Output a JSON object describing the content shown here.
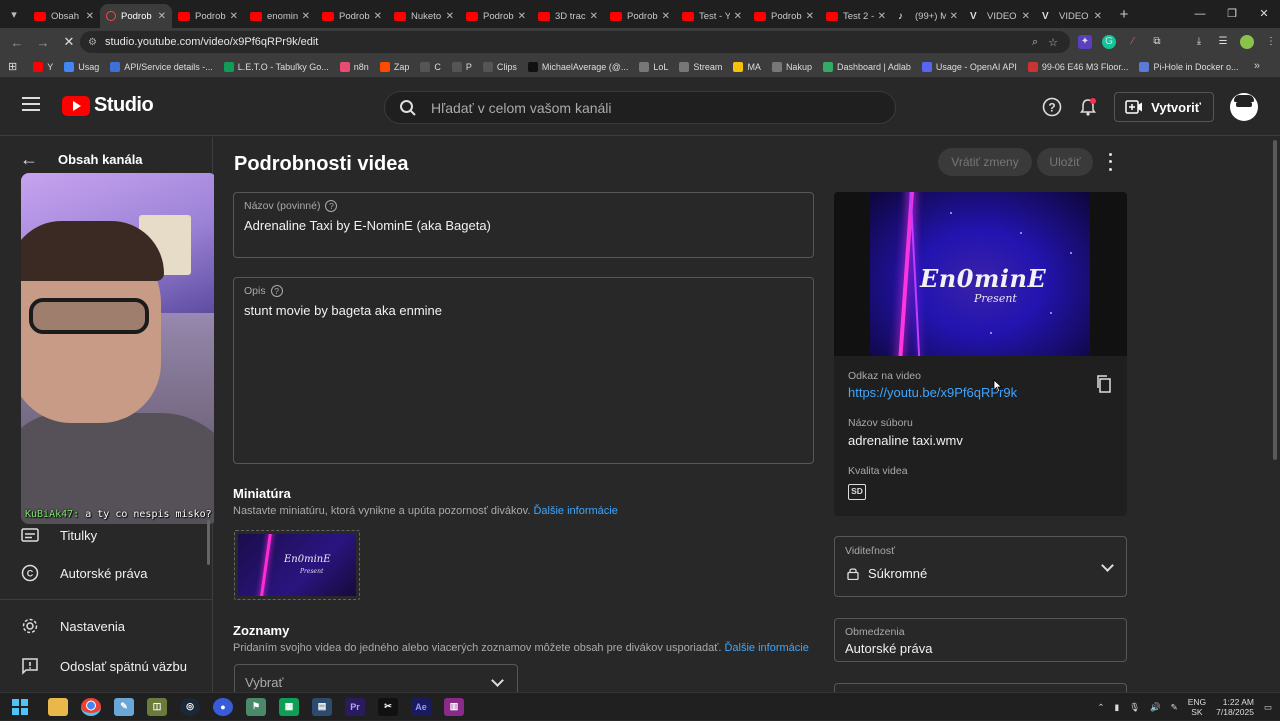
{
  "browser": {
    "tabs": [
      {
        "label": "Obsah",
        "icon": "youtube-icon"
      },
      {
        "label": "Podrob",
        "icon": "studio-icon",
        "active": true
      },
      {
        "label": "Podrob",
        "icon": "youtube-icon"
      },
      {
        "label": "enomin",
        "icon": "youtube-icon"
      },
      {
        "label": "Podrob",
        "icon": "youtube-icon"
      },
      {
        "label": "Nuketo",
        "icon": "youtube-icon"
      },
      {
        "label": "Podrob",
        "icon": "youtube-icon"
      },
      {
        "label": "3D trac",
        "icon": "youtube-icon"
      },
      {
        "label": "Podrob",
        "icon": "youtube-icon"
      },
      {
        "label": "Test - Y",
        "icon": "youtube-icon"
      },
      {
        "label": "Podrob",
        "icon": "youtube-icon"
      },
      {
        "label": "Test 2 -",
        "icon": "youtube-icon"
      },
      {
        "label": "(99+) M",
        "icon": "tiktok-icon"
      },
      {
        "label": "VIDEO",
        "icon": "v-icon"
      },
      {
        "label": "VIDEO",
        "icon": "v-icon"
      }
    ],
    "url": "studio.youtube.com/video/x9Pf6qRPr9k/edit",
    "bookmarks": [
      {
        "label": "Y",
        "color": "#ff0000"
      },
      {
        "label": "Usag",
        "color": "#4285f4"
      },
      {
        "label": "API/Service details -...",
        "color": "#3f6fd8"
      },
      {
        "label": "L.E.T.O - Tabuľky Go...",
        "color": "#0f9d58"
      },
      {
        "label": "n8n",
        "color": "#ea4b71"
      },
      {
        "label": "Zap",
        "color": "#ff4a00"
      },
      {
        "label": "C",
        "color": "#555555"
      },
      {
        "label": "P",
        "color": "#555555"
      },
      {
        "label": "Clips",
        "color": "#555555"
      },
      {
        "label": "MichaelAverage (@...",
        "color": "#111111"
      },
      {
        "label": "LoL",
        "color": "#777777"
      },
      {
        "label": "Stream",
        "color": "#777777"
      },
      {
        "label": "MA",
        "color": "#f4c20d"
      },
      {
        "label": "Nakup",
        "color": "#777777"
      },
      {
        "label": "Dashboard | Adlab",
        "color": "#33aa66"
      },
      {
        "label": "Usage - OpenAI API",
        "color": "#5865f2"
      },
      {
        "label": "99-06 E46 M3 Floor...",
        "color": "#cc3333"
      },
      {
        "label": "Pi-Hole in Docker o...",
        "color": "#5a7bd6"
      }
    ]
  },
  "header": {
    "logo_text": "Studio",
    "search_placeholder": "Hľadať v celom vašom kanáli",
    "create_label": "Vytvoriť"
  },
  "sidebar": {
    "back_label": "Obsah kanála",
    "chat_user": "KuBiAk47:",
    "chat_message": "a ty co nespis misko?",
    "items": [
      {
        "label": "Titulky",
        "icon": "subtitles-icon"
      },
      {
        "label": "Autorské práva",
        "icon": "copyright-icon"
      },
      {
        "label": "Nastavenia",
        "icon": "settings-gear-icon"
      },
      {
        "label": "Odoslať spätnú väzbu",
        "icon": "feedback-icon"
      }
    ]
  },
  "main": {
    "title": "Podrobnosti videa",
    "undo_label": "Vrátiť zmeny",
    "save_label": "Uložiť",
    "title_field": {
      "label": "Názov (povinné)",
      "value": "Adrenaline Taxi by E-NominE (aka Bageta)"
    },
    "desc_field": {
      "label": "Opis",
      "value": "stunt movie by bageta aka enmine"
    },
    "thumbnail": {
      "heading": "Miniatúra",
      "desc": "Nastavte miniatúru, ktorá vynikne a upúta pozornosť divákov.",
      "link": "Ďalšie informácie",
      "image_title": "En0minE",
      "image_subtitle": "Present"
    },
    "playlists": {
      "heading": "Zoznamy",
      "desc": "Pridaním svojho videa do jedného alebo viacerých zoznamov môžete obsah pre divákov usporiadať.",
      "link": "Ďalšie informácie",
      "select_value": "Vybrať"
    }
  },
  "video_card": {
    "preview_title": "En0minE",
    "preview_subtitle": "Present",
    "link_label": "Odkaz na video",
    "link_value": "https://youtu.be/x9Pf6qRPr9k",
    "filename_label": "Názov súboru",
    "filename_value": "adrenaline taxi.wmv",
    "quality_label": "Kvalita videa",
    "quality_badge": "SD"
  },
  "visibility": {
    "label": "Viditeľnosť",
    "value": "Súkromné"
  },
  "restrictions": {
    "label": "Obmedzenia",
    "value": "Autorské práva"
  },
  "taskbar": {
    "lang_top": "ENG",
    "lang_bottom": "SK",
    "time": "1:22 AM",
    "date": "7/18/2025"
  }
}
